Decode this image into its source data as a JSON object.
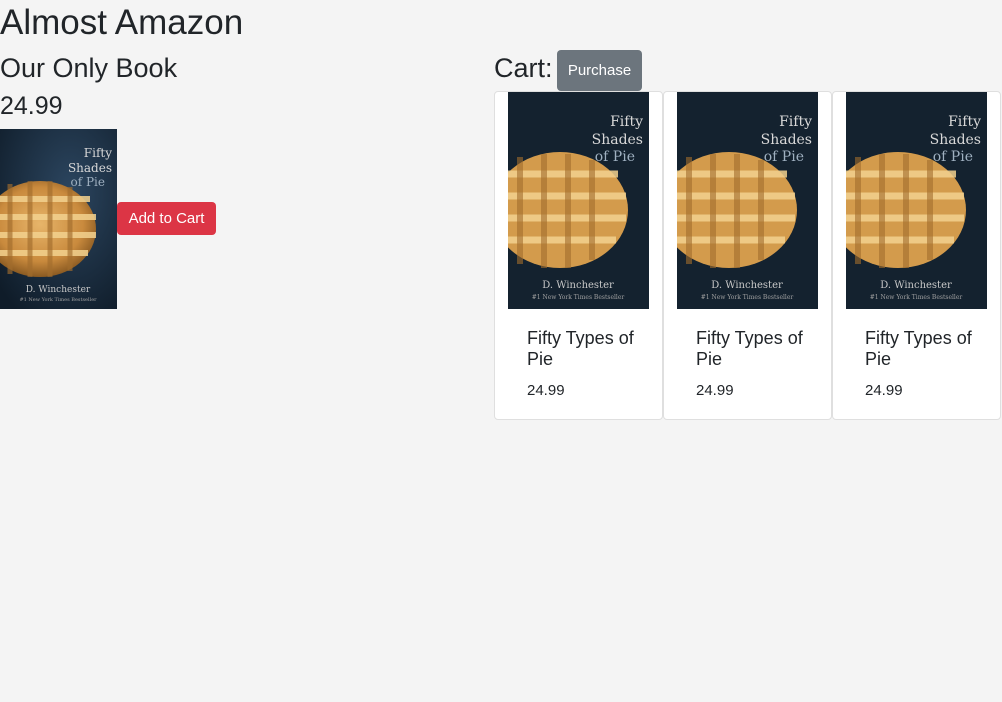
{
  "site": {
    "title": "Almost Amazon"
  },
  "book": {
    "heading": "Our Only Book",
    "price": "24.99",
    "cover": {
      "title_line1": "Fifty",
      "title_line2": "Shades",
      "title_line3": "of Pie",
      "author": "D. Winchester",
      "tagline": "#1 New York Times Bestseller"
    },
    "add_label": "Add to Cart"
  },
  "cart": {
    "heading": "Cart:",
    "purchase_label": "Purchase",
    "items": [
      {
        "title": "Fifty Types of Pie",
        "price": "24.99"
      },
      {
        "title": "Fifty Types of Pie",
        "price": "24.99"
      },
      {
        "title": "Fifty Types of Pie",
        "price": "24.99"
      }
    ]
  },
  "colors": {
    "page_bg": "#f4f4f4",
    "danger": "#dc3545",
    "secondary": "#6c757d"
  }
}
